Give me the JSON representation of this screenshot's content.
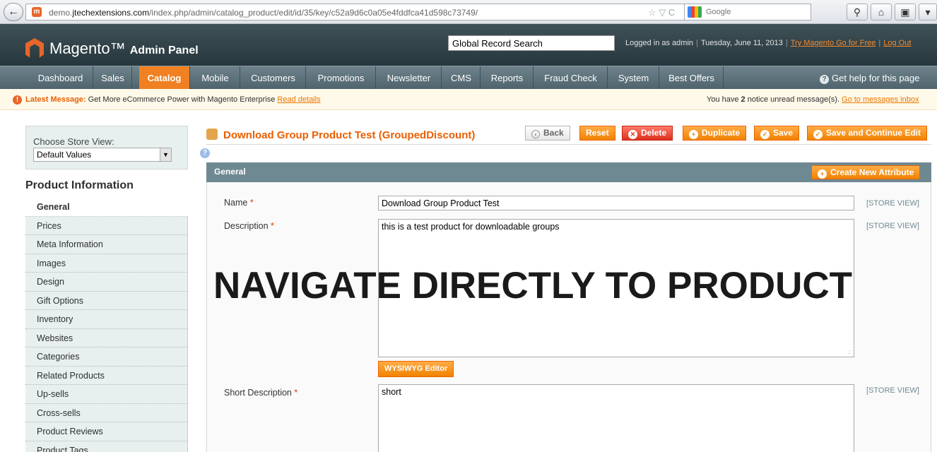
{
  "browser": {
    "url_prefix": "demo.",
    "url_domain": "jtechextensions.com",
    "url_path": "/index.php/admin/catalog_product/edit/id/35/key/c52a9d6c0a05e4fddfca41d598c73749/",
    "search_engine": "Google",
    "url_controls": "☆ ▽ C"
  },
  "header": {
    "brand": "Magento",
    "brand_suffix": "Admin Panel",
    "global_search": "Global Record Search",
    "logged_in": "Logged in as admin",
    "date": "Tuesday, June 11, 2013",
    "try_link": "Try Magento Go for Free",
    "logout": "Log Out",
    "sep": "|"
  },
  "nav": {
    "items": [
      "Dashboard",
      "Sales",
      "Catalog",
      "Mobile",
      "Customers",
      "Promotions",
      "Newsletter",
      "CMS",
      "Reports",
      "Fraud Check",
      "System",
      "Best Offers"
    ],
    "help": "Get help for this page"
  },
  "notice": {
    "label": "Latest Message:",
    "text": " Get More eCommerce Power with Magento Enterprise ",
    "read_details": "Read details",
    "count_pre": "You have ",
    "count": "2",
    "count_post": " notice unread message(s). ",
    "inbox": "Go to messages inbox"
  },
  "sidebar": {
    "store_view_label": "Choose Store View:",
    "store_view_value": "Default Values",
    "tabs_title": "Product Information",
    "tabs": [
      "General",
      "Prices",
      "Meta Information",
      "Images",
      "Design",
      "Gift Options",
      "Inventory",
      "Websites",
      "Categories",
      "Related Products",
      "Up-sells",
      "Cross-sells",
      "Product Reviews",
      "Product Tags"
    ]
  },
  "main": {
    "title": "Download Group Product Test (GroupedDiscount)",
    "buttons": {
      "back": "Back",
      "reset": "Reset",
      "delete": "Delete",
      "duplicate": "Duplicate",
      "save": "Save",
      "save_continue": "Save and Continue Edit"
    },
    "section_title": "General",
    "create_attribute": "Create New Attribute",
    "fields": {
      "name_label": "Name",
      "name_value": "Download Group Product Test",
      "description_label": "Description",
      "description_value": "this is a test product for downloadable groups",
      "wysiwyg": "WYSIWYG Editor",
      "short_label": "Short Description",
      "short_value": "short",
      "scope": "[STORE VIEW]",
      "required_mark": "*"
    },
    "overlay": "NAVIGATE DIRECTLY TO PRODUCT"
  },
  "colors": {
    "accent": "#eb5e00",
    "nav_active": "#f08021",
    "header_bg": "#2e3e45",
    "section_head": "#6f8992"
  }
}
